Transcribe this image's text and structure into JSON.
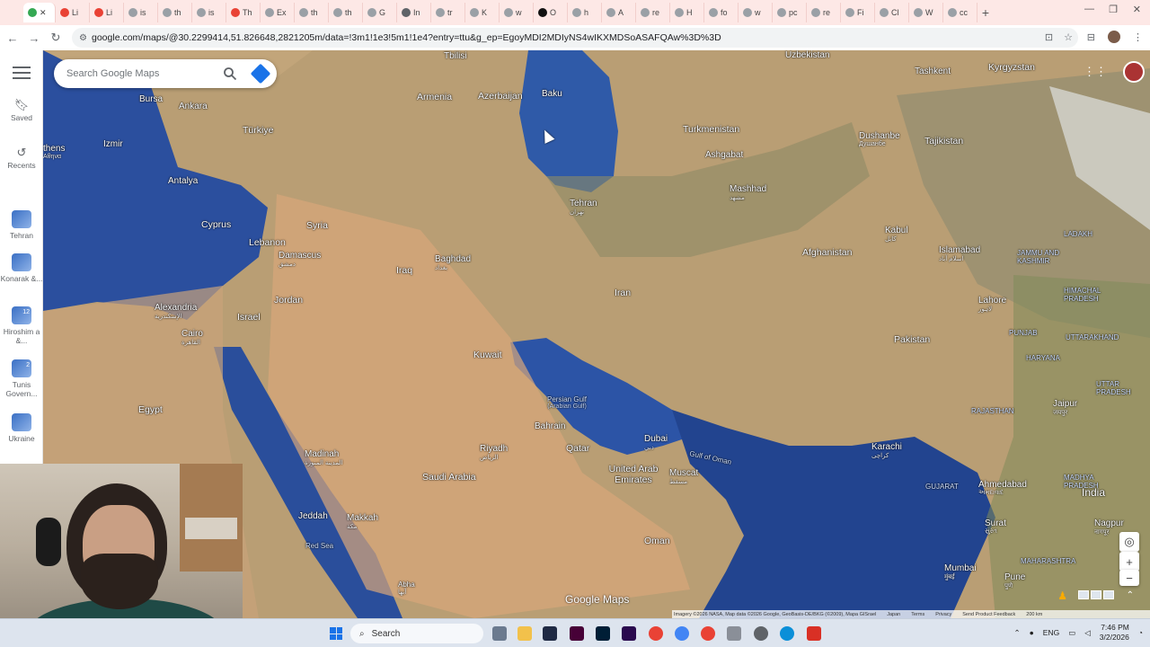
{
  "browser": {
    "tabs": [
      "",
      "Li",
      "Li",
      "is",
      "th",
      "is",
      "Th",
      "Ex",
      "th",
      "th",
      "G",
      "In",
      "tr",
      "K",
      "w",
      "O",
      "h",
      "A",
      "re",
      "H",
      "fo",
      "w",
      "pc",
      "re",
      "Fi",
      "Cl",
      "W",
      "cc"
    ],
    "new_tab_label": "+",
    "url": "google.com/maps/@30.2299414,51.826648,2821205m/data=!3m1!1e3!5m1!1e4?entry=ttu&g_ep=EgoyMDI2MDIyNS4wIKXMDSoASAFQAw%3D%3D"
  },
  "maps": {
    "search_placeholder": "Search Google Maps",
    "sidebar": {
      "saved_label": "Saved",
      "recents_label": "Recents",
      "recent_items": [
        {
          "label": "Tehran",
          "count": ""
        },
        {
          "label": "Konarak &...",
          "count": ""
        },
        {
          "label": "Hiroshim a &...",
          "count": "12"
        },
        {
          "label": "Tunis Govern...",
          "count": "2"
        },
        {
          "label": "Ukraine",
          "count": ""
        }
      ]
    },
    "places": {
      "uzbekistan": "Uzbekistan",
      "tashkent": "Tashkent",
      "kyrgyzstan": "Kyrgyzstan",
      "tbilisi": "Tbilisi",
      "armenia": "Armenia",
      "azerbaijan": "Azerbaijan",
      "baku": "Baku",
      "bursa": "Bursa",
      "ankara": "Ankara",
      "turkiye": "Türkiye",
      "izmir": "Izmir",
      "athens": "thens",
      "athens_local": "Αθηνα",
      "turkmenistan": "Turkmenistan",
      "ashgabat": "Ashgabat",
      "dushanbe": "Dushanbe",
      "dushanbe_local": "Душанбе",
      "tajikistan": "Tajikistan",
      "antalya": "Antalya",
      "cyprus": "Cyprus",
      "syria": "Syria",
      "lebanon": "Lebanon",
      "damascus": "Damascus",
      "damascus_local": "دمشق",
      "tehran": "Tehran",
      "tehran_local": "تهران",
      "mashhad": "Mashhad",
      "mashhad_local": "مشهد",
      "kabul": "Kabul",
      "kabul_local": "کابل",
      "islamabad": "Islamabad",
      "islamabad_local": "اسلام آباد",
      "jammu_kashmir": "JAMMU AND KASHMIR",
      "ladakh": "LADAKH",
      "iraq": "Iraq",
      "baghdad": "Baghdad",
      "baghdad_local": "بغداد",
      "afghanistan": "Afghanistan",
      "lahore": "Lahore",
      "lahore_local": "لاہور",
      "himachal": "HIMACHAL PRADESH",
      "alexandria": "Alexandria",
      "alexandria_local": "الإسكندرية",
      "israel": "Israel",
      "jordan": "Jordan",
      "iran": "Iran",
      "pakistan": "Pakistan",
      "punjab": "PUNJAB",
      "uttarakhand": "UTTARAKHAND",
      "cairo": "Cairo",
      "cairo_local": "القاهرة",
      "kuwait": "Kuwait",
      "haryana": "HARYANA",
      "persian_gulf": "Persian Gulf",
      "persian_gulf_alt": "(Arabian Gulf)",
      "egypt": "Egypt",
      "bahrain": "Bahrain",
      "uttar_pradesh": "UTTAR PRADESH",
      "rajasthan": "RAJASTHAN",
      "jaipur": "Jaipur",
      "jaipur_local": "जयपुर",
      "riyadh": "Riyadh",
      "riyadh_local": "الرياض",
      "dubai": "Dubai",
      "dubai_local": "دبي",
      "qatar": "Qatar",
      "gulf_of_oman": "Gulf of Oman",
      "karachi": "Karachi",
      "karachi_local": "کراچی",
      "madinah": "Madinah",
      "madinah_local": "المدينة المنورة",
      "uae": "United Arab Emirates",
      "muscat": "Muscat",
      "muscat_local": "مسقط",
      "saudi_arabia": "Saudi Arabia",
      "gujarat": "GUJARAT",
      "ahmedabad": "Ahmedabad",
      "ahmedabad_local": "અમદાવાદ",
      "madhya_pradesh": "MADHYA PRADESH",
      "india": "India",
      "jeddah": "Jeddah",
      "makkah": "Makkah",
      "makkah_local": "مكة",
      "surat": "Surat",
      "surat_local": "સુરત",
      "nagpur": "Nagpur",
      "nagpur_local": "नागपूर",
      "red_sea": "Red Sea",
      "oman": "Oman",
      "maharashtra": "MAHARASHTRA",
      "abha": "Abha",
      "abha_local": "أبها",
      "mumbai": "Mumbai",
      "mumbai_local": "मुंबई",
      "pune": "Pune",
      "pune_local": "पुणे"
    },
    "logo": "Google Maps",
    "attribution": {
      "imagery": "Imagery ©2026 NASA, Map data ©2026 Google, GeoBasis-DE/BKG (©2009), Mapa GISrael",
      "japan": "Japan",
      "terms": "Terms",
      "privacy": "Privacy",
      "feedback": "Send Product Feedback",
      "scale": "200 km"
    }
  },
  "taskbar": {
    "search_label": "Search",
    "language": "ENG",
    "time": "7:46 PM",
    "date": "3/2/2026"
  },
  "colors": {
    "tabstrip": "#fde8e6",
    "accent": "#1a73e8",
    "sea": "#2d4f9a",
    "land": "#b99e74"
  }
}
